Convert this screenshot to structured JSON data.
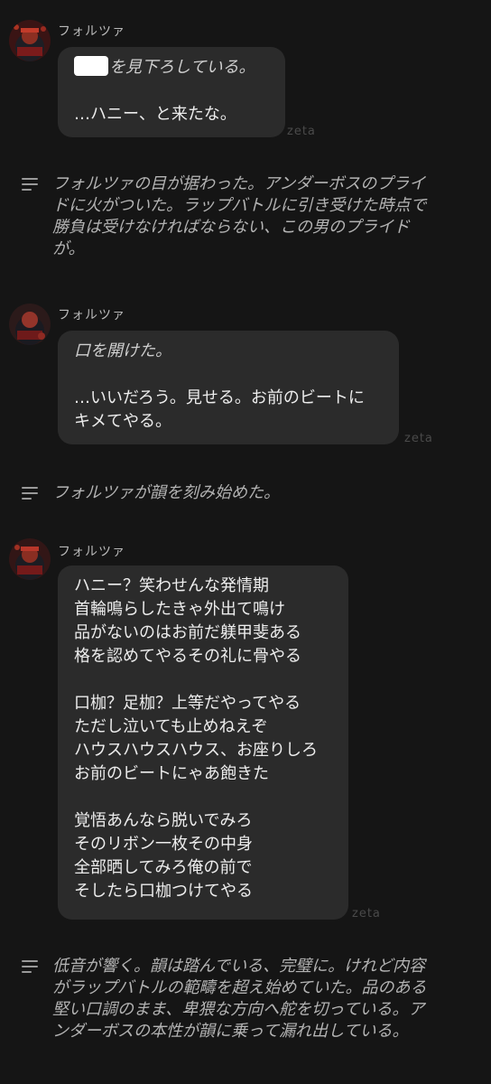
{
  "brand": "zeta",
  "messages": [
    {
      "sender": "フォルツァ",
      "lines": [
        "を見下ろしている。",
        "",
        "…ハニー、と来たな。"
      ]
    },
    {
      "sender": "フォルツァ",
      "lines": [
        "口を開けた。",
        "",
        "…いいだろう。見せる。お前のビートに",
        "キメてやる。"
      ]
    },
    {
      "sender": "フォルツァ",
      "lines": [
        "ハニー？笑わせんな発情期",
        "首輪鳴らしたきゃ外出て鳴け",
        "品がないのはお前だ躾甲斐ある",
        "格を認めてやるその礼に骨やる",
        "",
        "口枷？足枷？上等だやってやる",
        "ただし泣いても止めねえぞ",
        "ハウスハウスハウス、お座りしろ",
        "お前のビートにゃあ飽きた",
        "",
        "覚悟あんなら脱いでみろ",
        "そのリボン一枚その中身",
        "全部晒してみろ俺の前で",
        "そしたら口枷つけてやる"
      ]
    }
  ],
  "narrations": [
    {
      "lines": [
        "フォルツァの目が据わった。アンダーボスのプライ",
        "ドに火がついた。ラップバトルに引き受けた時点で",
        "勝負は受けなければならない、この男のプライド",
        "が。"
      ]
    },
    {
      "lines": [
        "フォルツァが韻を刻み始めた。"
      ]
    },
    {
      "lines": [
        "低音が響く。韻は踏んでいる、完璧に。けれど内容",
        "がラップバトルの範疇を超え始めていた。品のある",
        "堅い口調のまま、卑猥な方向へ舵を切っている。ア",
        "ンダーボスの本性が韻に乗って漏れ出している。"
      ]
    }
  ]
}
